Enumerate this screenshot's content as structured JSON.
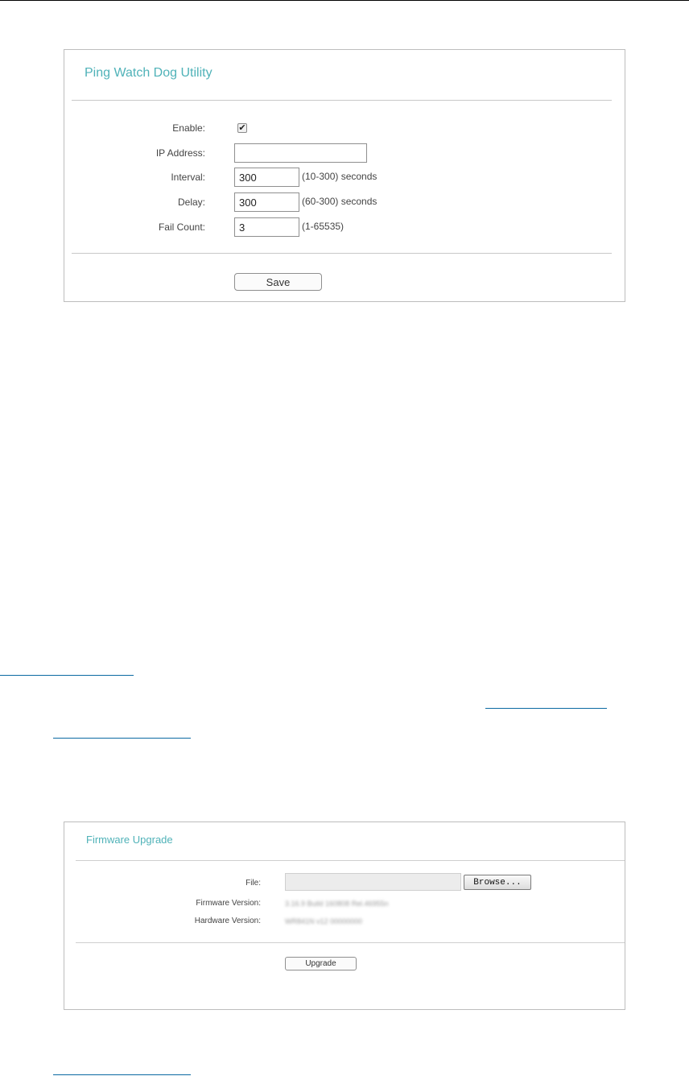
{
  "ping": {
    "title": "Ping Watch Dog Utility",
    "enable_label": "Enable:",
    "enable_checked": true,
    "ip_label": "IP Address:",
    "ip_value": "",
    "interval_label": "Interval:",
    "interval_value": "300",
    "interval_hint": "(10-300) seconds",
    "delay_label": "Delay:",
    "delay_value": "300",
    "delay_hint": "(60-300) seconds",
    "failcount_label": "Fail Count:",
    "failcount_value": "3",
    "failcount_hint": "(1-65535)",
    "save_label": "Save"
  },
  "firmware": {
    "title": "Firmware Upgrade",
    "file_label": "File:",
    "browse_label": "Browse...",
    "fw_version_label": "Firmware Version:",
    "fw_version_value": "3.16.9 Build 160808 Rel.46955n",
    "hw_version_label": "Hardware Version:",
    "hw_version_value": "WR841N v12 00000000",
    "upgrade_label": "Upgrade"
  },
  "colors": {
    "accent": "#4fb2b8",
    "link": "#0b6aa2"
  }
}
